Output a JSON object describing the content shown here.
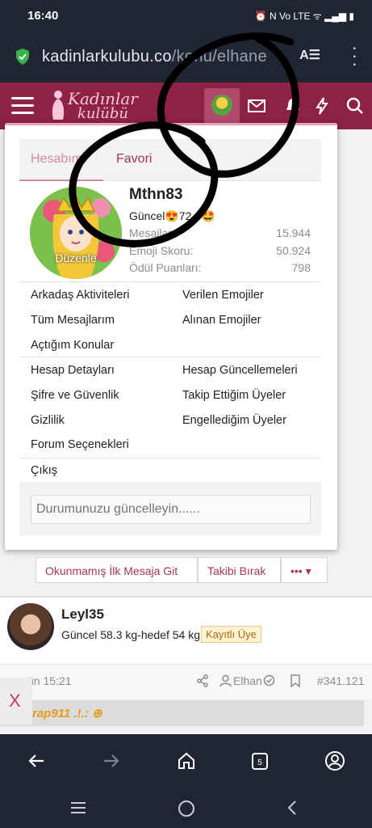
{
  "status_bar": {
    "time": "16:40",
    "icons": "⏰ N Vo LTE ᯤ ▂▄▆ ▮"
  },
  "browser": {
    "url_domain": "kadinlarkulubu.co",
    "url_path": "/konu/elhan",
    "url_tail": "e"
  },
  "site": {
    "logo_line1": "Kadınlar",
    "logo_line2": "kulübü"
  },
  "account_popup": {
    "tabs": [
      {
        "label": "Hesabım"
      },
      {
        "label": "Favori"
      }
    ],
    "avatar_edit_label": "Düzenle",
    "username": "Mthn83",
    "status": "Güncel😍72.6🤩",
    "stats": [
      {
        "label": "Mesajlar:",
        "value": "15.944"
      },
      {
        "label": "Emoji Skoru:",
        "value": "50.924"
      },
      {
        "label": "Ödül Puanları:",
        "value": "798"
      }
    ],
    "menu_group1": {
      "left": [
        "Arkadaş Aktiviteleri",
        "Tüm Mesajlarım",
        "Açtığım Konular"
      ],
      "right": [
        "Verilen Emojiler",
        "Alınan Emojiler"
      ]
    },
    "menu_group2": {
      "left": [
        "Hesap Detayları",
        "Şifre ve Güvenlik",
        "Gizlilik",
        "Forum Seçenekleri"
      ],
      "right": [
        "Hesap Güncellemeleri",
        "Takip Ettiğim Üyeler",
        "Engellediğim Üyeler"
      ]
    },
    "logout": "Çıkış",
    "status_placeholder": "Durumunuzu güncelleyin......"
  },
  "thread_actions": {
    "unread": "Okunmamış İlk Mesaja Git",
    "unfollow": "Takibi Bırak",
    "more": "••• ▾"
  },
  "post": {
    "user": "Leyl35",
    "status": "Güncel 58.3 kg-hedef 54 kg",
    "badge": "Kayıtlı Üye",
    "time": "ün 15:21",
    "quoted_user": "Elhan",
    "post_number": "#341.121",
    "quote_text": "rap911 .!.: ⊕"
  },
  "close_label": "X"
}
